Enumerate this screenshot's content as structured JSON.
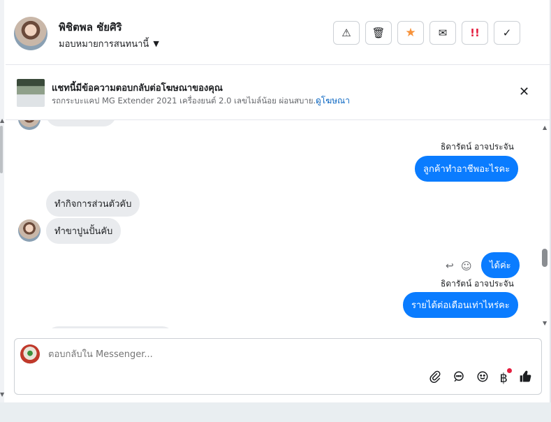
{
  "header": {
    "name": "พิชิตพล ชัยศิริ",
    "assign_label": "มอบหมายการสนทนานี้",
    "caret": "▼",
    "toolbar": {
      "report": "⚠",
      "trash": "🗑",
      "star": "★",
      "mail": "✉",
      "urgent": "!!",
      "done": "✓"
    }
  },
  "ad": {
    "title": "แชทนี้มีข้อความตอบกลับต่อโฆษณาของคุณ",
    "subtitle": "รถกระบะแคป MG Extender 2021 เครื่องยนต์ 2.0 เลขไมล์น้อย ผ่อนสบาย...",
    "link": "ดูโฆษณา",
    "close": "✕"
  },
  "messages": {
    "sender1": "ธิดารัตน์ อาจประจัน",
    "out1": "ลูกค้าทำอาชีพอะไรคะ",
    "in1": "ทำกิจการส่วนตัวคับ",
    "in2": "ทำขาปูนปั้นคับ",
    "out2": "ได้ค่ะ",
    "sender2": "ธิดารัตน์ อาจประจัน",
    "out3": "รายได้ต่อเดือนเท่าไหร่คะ"
  },
  "composer": {
    "placeholder": "ตอบกลับใน Messenger...",
    "icons": [
      "paperclip-icon",
      "chat-bubble-icon",
      "emoji-icon",
      "baht-icon",
      "thumbs-up-icon"
    ],
    "baht": "฿"
  },
  "colors": {
    "accent": "#0a7cff",
    "link": "#0a66c2",
    "star": "#f7923a",
    "urgent": "#e41e3f"
  }
}
